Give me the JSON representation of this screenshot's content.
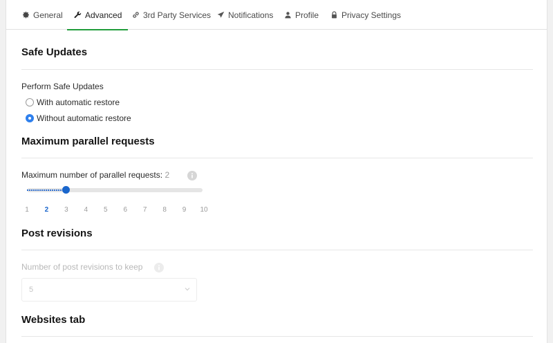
{
  "tabs": [
    {
      "label": "General",
      "icon": "gear-icon"
    },
    {
      "label": "Advanced",
      "icon": "wrench-icon"
    },
    {
      "label": "3rd Party Services",
      "icon": "link-icon"
    },
    {
      "label": "Notifications",
      "icon": "send-icon"
    },
    {
      "label": "Profile",
      "icon": "person-icon"
    },
    {
      "label": "Privacy Settings",
      "icon": "lock-icon"
    }
  ],
  "active_tab": "Advanced",
  "safe_updates": {
    "title": "Safe Updates",
    "field_label": "Perform Safe Updates",
    "options": [
      {
        "label": "With automatic restore",
        "checked": false
      },
      {
        "label": "Without automatic restore",
        "checked": true
      }
    ]
  },
  "parallel": {
    "title": "Maximum parallel requests",
    "field_label": "Maximum number of parallel requests:",
    "value": "2",
    "ticks": [
      "1",
      "2",
      "3",
      "4",
      "5",
      "6",
      "7",
      "8",
      "9",
      "10"
    ],
    "min": 1,
    "max": 10
  },
  "revisions": {
    "title": "Post revisions",
    "field_label": "Number of post revisions to keep",
    "selected": "5"
  },
  "websites": {
    "title": "Websites tab"
  },
  "colors": {
    "accent": "#1f9c3a",
    "primary": "#1a66cc"
  }
}
